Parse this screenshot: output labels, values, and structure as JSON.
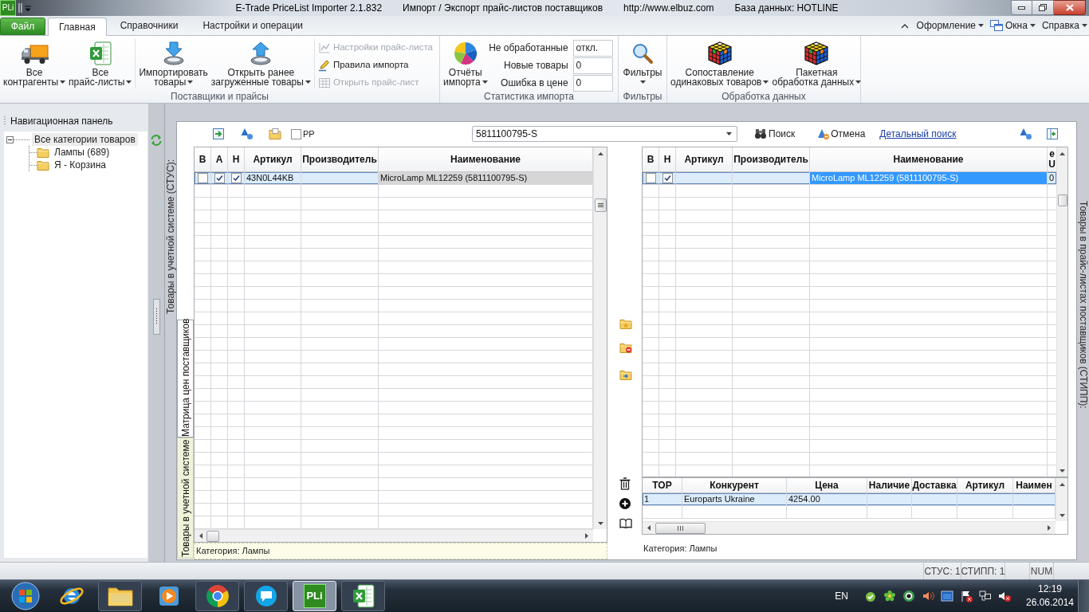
{
  "window": {
    "app_badge": "PLi",
    "title": [
      "E-Trade PriceList Importer 2.1.832",
      "Импорт / Экспорт прайс-листов поставщиков",
      "http://www.elbuz.com",
      "База данных: HOTLINE"
    ]
  },
  "ribbon": {
    "file_button": "Файл",
    "tabs": [
      {
        "label": "Главная",
        "selected": true
      },
      {
        "label": "Справочники",
        "selected": false
      },
      {
        "label": "Настройки и операции",
        "selected": false
      }
    ],
    "menus": [
      "Оформление",
      "Окна",
      "Справка"
    ],
    "groups": [
      {
        "title": "Поставщики и прайсы",
        "items": [
          {
            "kind": "large",
            "lines": [
              "Все",
              "контрагенты"
            ],
            "dropdown": true
          },
          {
            "kind": "large",
            "lines": [
              "Все",
              "прайс-листы"
            ],
            "dropdown": true
          },
          {
            "kind": "separator"
          },
          {
            "kind": "large",
            "lines": [
              "Импортировать",
              "товары"
            ],
            "dropdown": true
          },
          {
            "kind": "large",
            "lines": [
              "Открыть ранее",
              "загруженные товары"
            ],
            "dropdown": true
          },
          {
            "kind": "separator"
          },
          {
            "kind": "stack",
            "buttons": [
              {
                "label": "Настройки прайс-листа",
                "disabled": true
              },
              {
                "label": "Правила импорта",
                "disabled": false
              },
              {
                "label": "Открыть прайс-лист",
                "disabled": true
              }
            ]
          }
        ]
      },
      {
        "title": "Статистика импорта",
        "items": [
          {
            "kind": "large",
            "lines": [
              "Отчёты",
              "импорта"
            ],
            "dropdown": true
          },
          {
            "kind": "stats",
            "fields": [
              {
                "label": "Не обработанные",
                "value": "откл."
              },
              {
                "label": "Новые товары",
                "value": "0"
              },
              {
                "label": "Ошибка в цене",
                "value": "0"
              }
            ]
          }
        ]
      },
      {
        "title": "Фильтры",
        "items": [
          {
            "kind": "large",
            "lines": [
              "Фильтры"
            ],
            "dropdown": true
          }
        ]
      },
      {
        "title": "Обработка данных",
        "items": [
          {
            "kind": "large",
            "lines": [
              "Сопоставление",
              "одинаковых товаров"
            ],
            "dropdown": true
          },
          {
            "kind": "large",
            "lines": [
              "Пакетная",
              "обработка данных"
            ],
            "dropdown": true
          }
        ]
      }
    ]
  },
  "nav": {
    "title": "Навигационная панель",
    "tree": [
      {
        "label": "Все категории товаров",
        "selected": true,
        "expanded": true,
        "children": [
          {
            "label": "Лампы (689)",
            "selected": false
          },
          {
            "label": "Я - Корзина",
            "selected": false
          }
        ]
      }
    ]
  },
  "workspace": {
    "left_caption": "Товары в учетной системе (СТУС):",
    "right_caption": "Товары в прайс-листах поставщиков (СТИПП):",
    "side_tabs": [
      {
        "label": "Матрица цен поставщиков",
        "selected": true
      },
      {
        "label": "Товары в учетной системе",
        "selected": false
      }
    ],
    "toolbar": {
      "pp": {
        "label": "PP",
        "checked": false
      },
      "search": {
        "value": "5811100795-S"
      },
      "search_button": "Поиск",
      "cancel_button": "Отмена",
      "detail_link": "Детальный поиск"
    },
    "left_table": {
      "focused": false,
      "columns": [
        "В",
        "А",
        "Н",
        "Артикул",
        "Производитель",
        "Наименование"
      ],
      "rows": [
        {
          "selected": true,
          "cells": [
            {
              "kind": "check",
              "checked": false
            },
            {
              "kind": "check",
              "checked": true
            },
            {
              "kind": "check",
              "checked": true
            },
            {
              "kind": "text",
              "text": "43N0L44KB",
              "current": false
            },
            {
              "kind": "text"
            },
            {
              "kind": "text",
              "text": "MicroLamp ML12259 (5811100795-S)",
              "current": true
            }
          ]
        }
      ],
      "footer": "Категория: Лампы"
    },
    "right_table": {
      "focused": true,
      "columns": [
        "В",
        "Н",
        "Артикул",
        "Производитель",
        "Наименование",
        "е\nU"
      ],
      "rows": [
        {
          "selected": true,
          "cells": [
            {
              "kind": "check",
              "checked": false
            },
            {
              "kind": "check",
              "checked": true
            },
            {
              "kind": "text"
            },
            {
              "kind": "text"
            },
            {
              "kind": "text",
              "text": "MicroLamp ML12259 (5811100795-S)",
              "current": true
            },
            {
              "kind": "text",
              "text": "0",
              "current": false
            }
          ]
        }
      ]
    },
    "competitors_table": {
      "columns": [
        "ТОР",
        "Конкурент",
        "Цена",
        "Наличие",
        "Доставка",
        "Артикул",
        "Наимен"
      ],
      "rows": [
        {
          "selected": true,
          "cells": [
            {
              "kind": "text",
              "text": "1",
              "current": false
            },
            {
              "kind": "text",
              "text": "Europarts Ukraine",
              "current": false
            },
            {
              "kind": "text",
              "text": "4254.00",
              "current": false
            }
          ]
        }
      ],
      "footer": "Категория: Лампы"
    }
  },
  "status_bar": [
    "СТУС: 1",
    "СТИПП: 1",
    "NUM"
  ],
  "taskbar": {
    "apps": [
      {
        "running": false
      },
      {
        "running": true,
        "selected": false
      },
      {
        "running": false
      },
      {
        "running": true,
        "selected": false
      },
      {
        "running": true,
        "selected": false
      },
      {
        "running": true,
        "selected": true,
        "badge": "PLi"
      },
      {
        "running": true,
        "selected": false
      }
    ],
    "language": "EN",
    "time": "12:19",
    "date": "26.06.2014"
  }
}
